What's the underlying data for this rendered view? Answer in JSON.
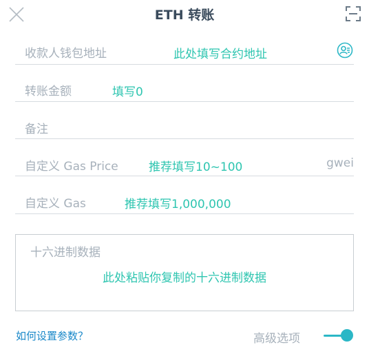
{
  "header": {
    "title": "ETH 转账",
    "close_icon": "close-icon",
    "scan_icon": "scan-icon"
  },
  "form": {
    "address": {
      "label": "收款人钱包地址",
      "hint": "此处填写合约地址",
      "icon": "contact-icon"
    },
    "amount": {
      "label": "转账金额",
      "hint": "填写0"
    },
    "memo": {
      "label": "备注"
    },
    "gas_price": {
      "label": "自定义 Gas Price",
      "hint": "推荐填写10~100",
      "unit": "gwei"
    },
    "gas": {
      "label": "自定义 Gas",
      "hint": "推荐填写1,000,000"
    },
    "hex_data": {
      "label": "十六进制数据",
      "hint": "此处粘贴你复制的十六进制数据"
    }
  },
  "footer": {
    "help_link": "如何设置参数？",
    "advanced_label": "高级选项",
    "advanced_enabled": true
  },
  "colors": {
    "accent": "#2ec5b0",
    "link": "#1a88c9",
    "toggle": "#2bb7c6"
  }
}
